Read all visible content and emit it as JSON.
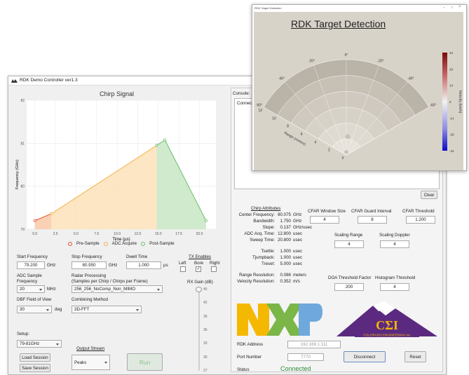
{
  "main_window": {
    "title": "RDK Demo Controller ver1.3"
  },
  "chart": {
    "title": "Chirp Signal",
    "ylabel": "Frequency (GHz)",
    "xlabel": "Time (µs)",
    "y_ticks": [
      "82",
      "81",
      "80",
      "79"
    ],
    "x_ticks": [
      "0.0",
      "2.5",
      "5.0",
      "7.5",
      "10.0",
      "12.5",
      "15.0",
      "17.5",
      "20.0"
    ],
    "legend": [
      "Pre-Sample",
      "ADC Acquire",
      "Post-Sample"
    ],
    "colors": {
      "pre": "#e8502a",
      "adc": "#f5b24a",
      "post": "#6cbf6c"
    }
  },
  "chart_data": {
    "type": "area",
    "title": "Chirp Signal",
    "xlabel": "Time (µs)",
    "ylabel": "Frequency (GHz)",
    "xlim": [
      -1,
      22
    ],
    "ylim": [
      79,
      82
    ],
    "series": [
      {
        "name": "Pre-Sample",
        "x": [
          0.0,
          2.0
        ],
        "y": [
          79.2,
          79.36
        ]
      },
      {
        "name": "ADC Acquire",
        "x": [
          2.0,
          14.8
        ],
        "y": [
          79.36,
          80.95
        ]
      },
      {
        "name": "Post-Sample",
        "x": [
          14.8,
          15.8,
          20.8
        ],
        "y": [
          80.95,
          81.075,
          79.2
        ]
      }
    ]
  },
  "form": {
    "start_freq": {
      "label": "Start Frequency",
      "value": "79.200",
      "unit": "GHz"
    },
    "stop_freq": {
      "label": "Stop Frequency",
      "value": "80.950",
      "unit": "GHz"
    },
    "dwell": {
      "label": "Dwell Time",
      "value": "1.000",
      "unit": "µs"
    },
    "tx": {
      "label": "TX Enables",
      "left": "Left",
      "bore": "Bore",
      "right": "Right"
    },
    "adc": {
      "label1": "ADC Sample",
      "label2": "Frequency",
      "value": "20",
      "unit": "MHz"
    },
    "radar": {
      "label1": "Radar Processing",
      "label2": "(Samples per Chirp / Chirps per Frame)",
      "value": "256_256_NoComp_Non_MIMO"
    },
    "rx_gain": {
      "label": "RX Gain (dB)",
      "ticks": [
        "45",
        "42",
        "39",
        "36",
        "33",
        "30",
        "27"
      ]
    },
    "dbf": {
      "label": "DBF Field of View",
      "value": "30",
      "unit": "deg"
    },
    "combining": {
      "label": "Combining Method",
      "value": "3D-FFT"
    },
    "setup": {
      "label": "Setup:",
      "value": "79-81GHz"
    },
    "load_session": "Load Session",
    "save_session": "Save Session",
    "output_stream": {
      "label": "Output Stream",
      "value": "Peaks"
    },
    "run": "Run"
  },
  "console": {
    "label": "Console:",
    "text": "Connecte"
  },
  "clear": "Clear",
  "chirp_attributes": {
    "title": "Chirp Attributes",
    "rows": [
      {
        "label": "Center Frequency:",
        "value": "80.075",
        "unit": "GHz"
      },
      {
        "label": "Bandwidth:",
        "value": "1.750",
        "unit": "GHz"
      },
      {
        "label": "Slope:",
        "value": "0.137",
        "unit": "GHz/usec"
      },
      {
        "label": "ADC Acq. Time:",
        "value": "12.800",
        "unit": "usec"
      },
      {
        "label": "Sweep Time:",
        "value": "20.800",
        "unit": "usec"
      },
      {
        "label": "Tsettle:",
        "value": "1.000",
        "unit": "usec"
      },
      {
        "label": "Tjumpback:",
        "value": "1.000",
        "unit": "usec"
      },
      {
        "label": "Treset:",
        "value": "5.000",
        "unit": "usec"
      },
      {
        "label": "Range Resolution:",
        "value": "0.086",
        "unit": "meters"
      },
      {
        "label": "Velocity Resolution:",
        "value": "0.352",
        "unit": "m/s"
      }
    ]
  },
  "cfar": {
    "window_size": {
      "label": "CFAR Window Size",
      "value": "4"
    },
    "guard": {
      "label": "CFAR Guard Interval",
      "value": "8"
    },
    "threshold": {
      "label": "CFAR Threshold",
      "value": "1.200"
    },
    "scaling_range": {
      "label": "Scaling Range",
      "value": "4"
    },
    "scaling_doppler": {
      "label": "Scaling Doppler",
      "value": "4"
    },
    "doa": {
      "label": "DOA Threshold Factor",
      "value": "200"
    },
    "histogram": {
      "label": "Histogram Threshold",
      "value": "4"
    }
  },
  "logos": {
    "nxp": "NXP",
    "cei": "CΣI",
    "cei_sub": "COLORADO ENGINEERING Inc"
  },
  "connection": {
    "address_label": "RDK Address",
    "address": "192.168.1.111",
    "port_label": "Port Number",
    "port": "7770",
    "status_label": "Status",
    "status": "Connected",
    "disconnect": "Disconnect",
    "reset": "Reset"
  },
  "target_detection": {
    "window_title": "RDK Target Detection",
    "title": "RDK Target Detection",
    "angle_labels": [
      "0°",
      "20°",
      "-20°",
      "40°",
      "-40°",
      "60°",
      "-60°"
    ],
    "range_labels": [
      "12",
      "10",
      "8",
      "6",
      "4",
      "2",
      "0"
    ],
    "range_axis": "Range (meters)",
    "colorbar_ticks": [
      "44",
      "29",
      "14",
      "0",
      "-14",
      "-29",
      "-44"
    ],
    "colorbar_label": "Velocity (km/h)",
    "colors": {
      "pos": "#9b1c1c",
      "zero": "#f2f2f2",
      "neg": "#1414c8"
    }
  }
}
